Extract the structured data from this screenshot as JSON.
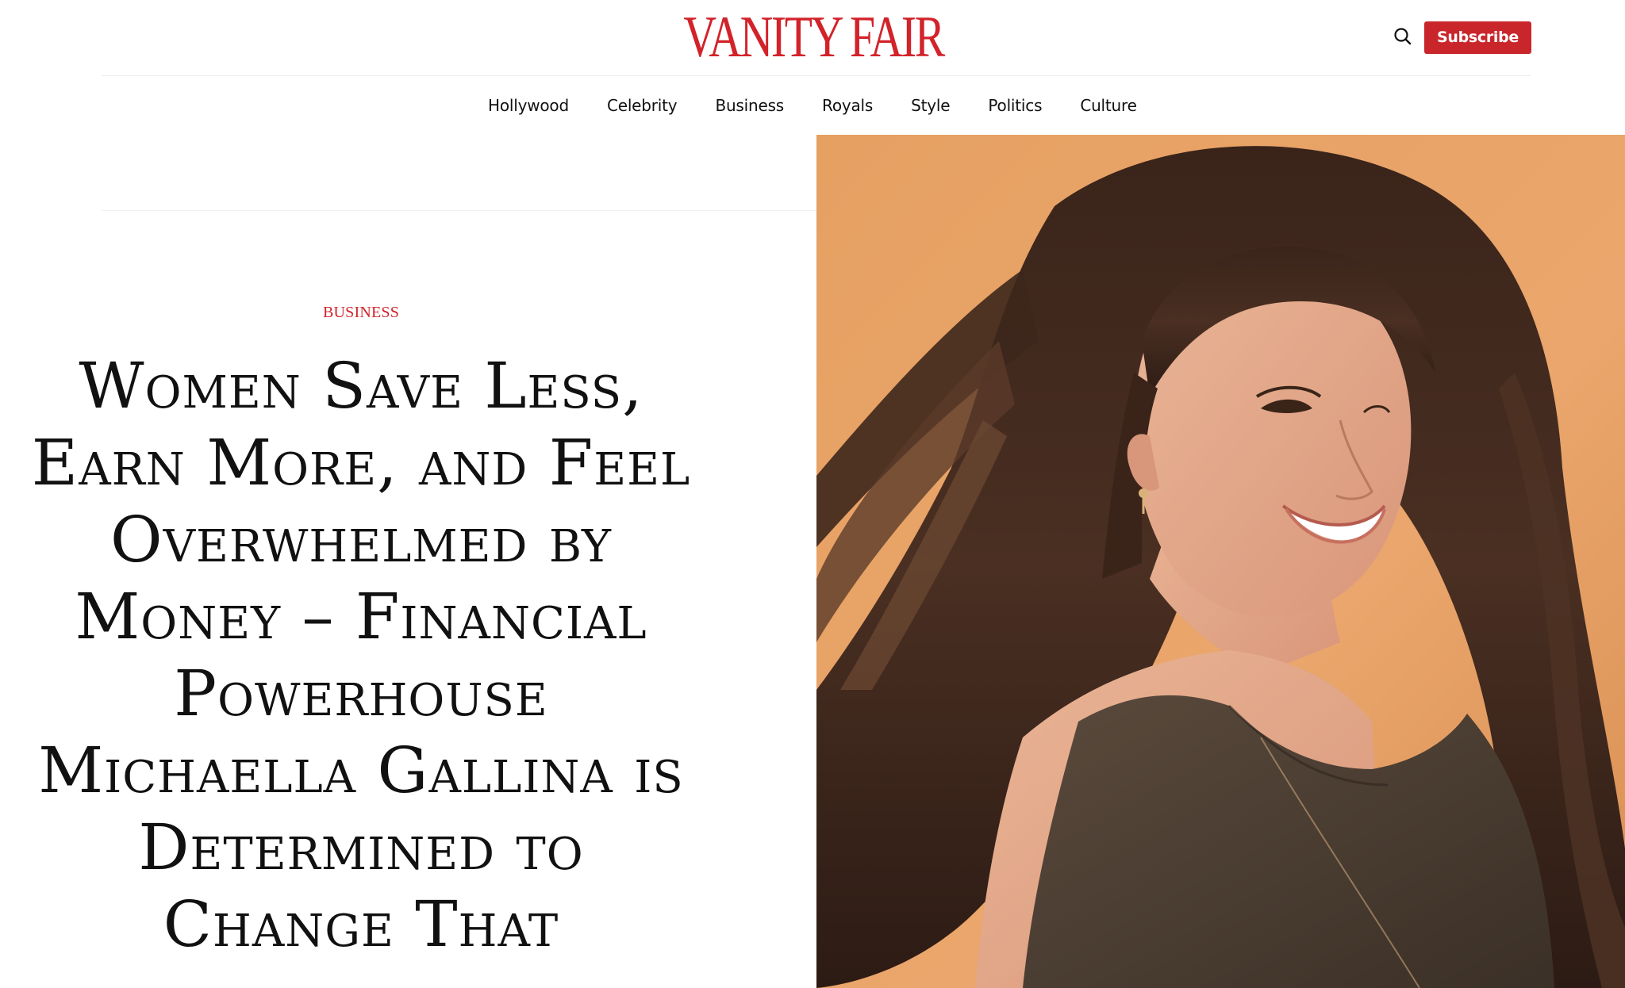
{
  "header": {
    "logo_text": "VANITY FAIR",
    "subscribe_label": "Subscribe",
    "search_icon": "search-icon"
  },
  "nav": {
    "items": [
      {
        "label": "Hollywood"
      },
      {
        "label": "Celebrity"
      },
      {
        "label": "Business"
      },
      {
        "label": "Royals"
      },
      {
        "label": "Style"
      },
      {
        "label": "Politics"
      },
      {
        "label": "Culture"
      }
    ]
  },
  "article": {
    "rubric": "BUSINESS",
    "headline": "Women Save Less, Earn More, and Feel Overwhelmed by Money – Financial Powerhouse Michaella Gallina is Determined to Change That",
    "image_alt": "Michaella Gallina"
  },
  "colors": {
    "brand_red": "#d2232a",
    "subscribe_bg": "#c9262c",
    "text": "#111111",
    "image_background": "#e9a46a"
  }
}
